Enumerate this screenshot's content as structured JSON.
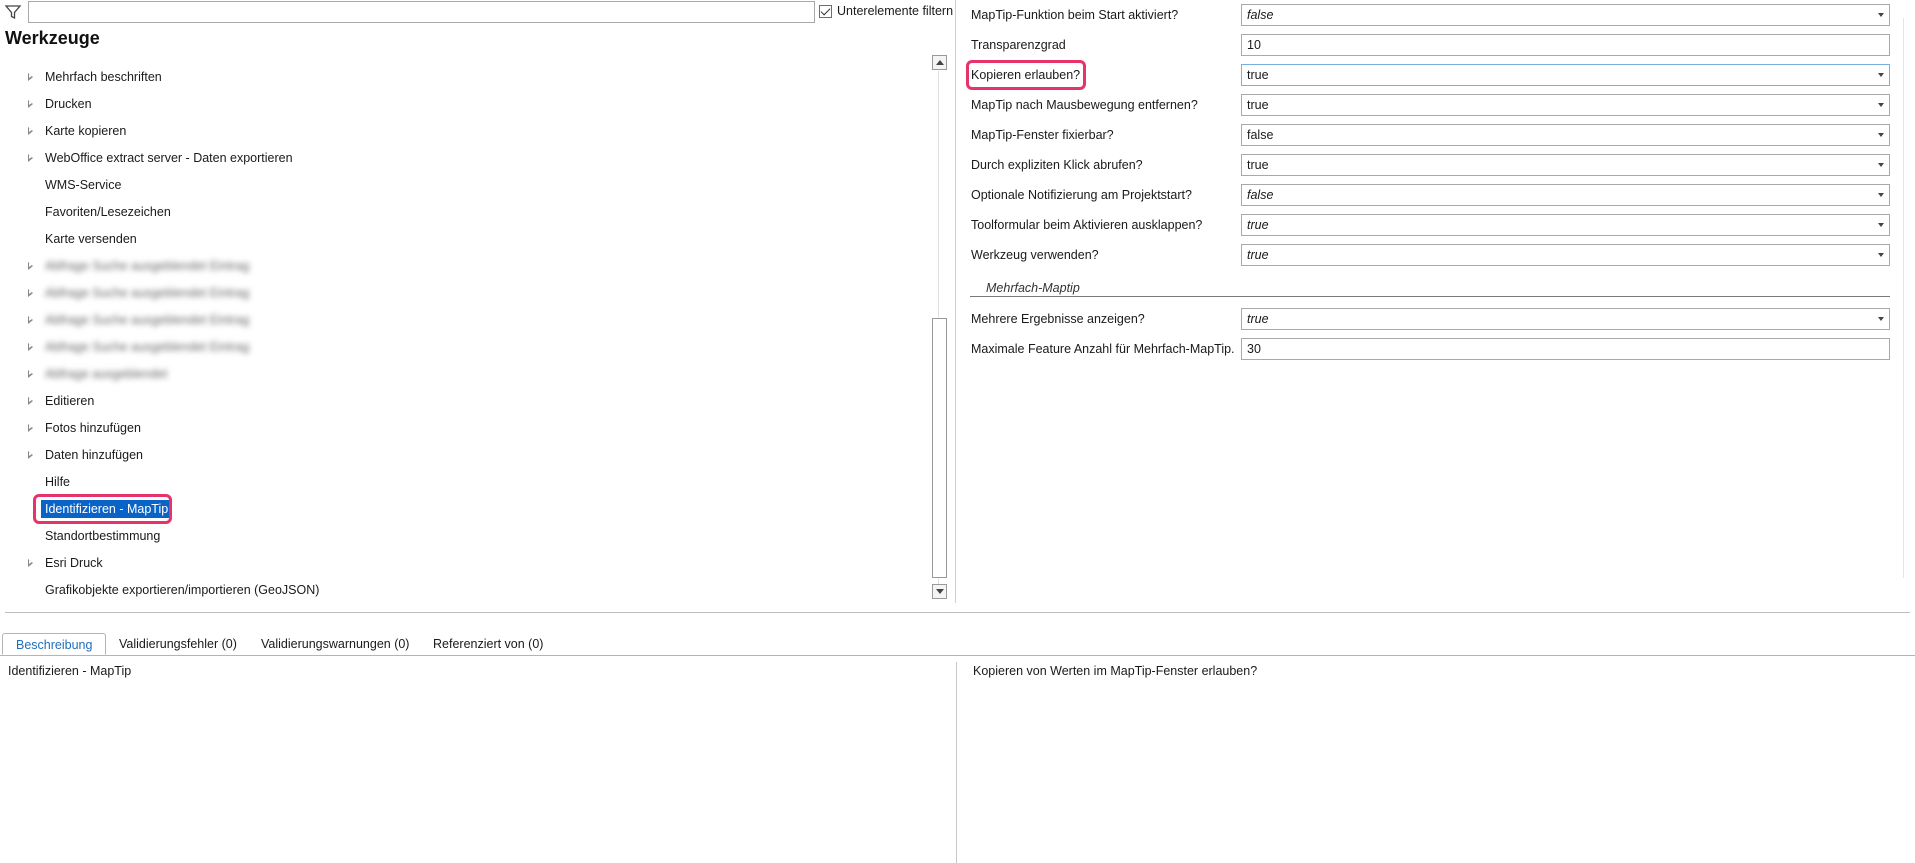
{
  "filter": {
    "input_value": "",
    "sub_filter_label": "Unterelemente filtern",
    "sub_filter_checked": true
  },
  "tree": {
    "title": "Werkzeuge",
    "items": [
      {
        "label": "Mehrfach beschriften",
        "expandable": true
      },
      {
        "label": "Drucken",
        "expandable": true
      },
      {
        "label": "Karte kopieren",
        "expandable": true
      },
      {
        "label": "WebOffice extract server - Daten exportieren",
        "expandable": true
      },
      {
        "label": "WMS-Service",
        "expandable": false
      },
      {
        "label": "Favoriten/Lesezeichen",
        "expandable": false
      },
      {
        "label": "Karte versenden",
        "expandable": false
      },
      {
        "label": "Abfrage Suche ausgeblendet Eintrag",
        "expandable": true,
        "blurred": true
      },
      {
        "label": "Abfrage Suche ausgeblendet Eintrag",
        "expandable": true,
        "blurred": true
      },
      {
        "label": "Abfrage Suche ausgeblendet Eintrag",
        "expandable": true,
        "blurred": true
      },
      {
        "label": "Abfrage Suche ausgeblendet Eintrag",
        "expandable": true,
        "blurred": true
      },
      {
        "label": "Abfrage ausgeblendet",
        "expandable": true,
        "blurred": true
      },
      {
        "label": "Editieren",
        "expandable": true
      },
      {
        "label": "Fotos hinzufügen",
        "expandable": true
      },
      {
        "label": "Daten hinzufügen",
        "expandable": true
      },
      {
        "label": "Hilfe",
        "expandable": false
      },
      {
        "label": "Identifizieren - MapTip",
        "expandable": false,
        "selected": true
      },
      {
        "label": "Standortbestimmung",
        "expandable": false
      },
      {
        "label": "Esri Druck",
        "expandable": true
      },
      {
        "label": "Grafikobjekte exportieren/importieren (GeoJSON)",
        "expandable": false
      }
    ]
  },
  "properties": {
    "rows": [
      {
        "label": "MapTip-Funktion beim Start aktiviert?",
        "value": "false",
        "italic": true,
        "dropdown": true
      },
      {
        "label": "Transparenzgrad",
        "value": "10",
        "italic": false,
        "dropdown": false
      },
      {
        "label": "Kopieren erlauben?",
        "value": "true",
        "italic": false,
        "dropdown": true,
        "highlighted": true
      },
      {
        "label": "MapTip nach Mausbewegung entfernen?",
        "value": "true",
        "italic": false,
        "dropdown": true
      },
      {
        "label": "MapTip-Fenster fixierbar?",
        "value": "false",
        "italic": false,
        "dropdown": true
      },
      {
        "label": "Durch expliziten Klick abrufen?",
        "value": "true",
        "italic": false,
        "dropdown": true
      },
      {
        "label": "Optionale Notifizierung am Projektstart?",
        "value": "false",
        "italic": true,
        "dropdown": true
      },
      {
        "label": "Toolformular beim Aktivieren ausklappen?",
        "value": "true",
        "italic": true,
        "dropdown": true
      },
      {
        "label": "Werkzeug verwenden?",
        "value": "true",
        "italic": true,
        "dropdown": true
      }
    ],
    "section": "Mehrfach-Maptip",
    "section_rows": [
      {
        "label": "Mehrere Ergebnisse anzeigen?",
        "value": "true",
        "italic": true,
        "dropdown": true
      },
      {
        "label": "Maximale Feature Anzahl für Mehrfach-MapTip.",
        "value": "30",
        "italic": false,
        "dropdown": false
      }
    ]
  },
  "tabs": [
    {
      "label": "Beschreibung",
      "active": true
    },
    {
      "label": "Validierungsfehler (0)",
      "active": false
    },
    {
      "label": "Validierungswarnungen (0)",
      "active": false
    },
    {
      "label": "Referenziert von (0)",
      "active": false
    }
  ],
  "description": {
    "left": "Identifizieren - MapTip",
    "right": "Kopieren von Werten im MapTip-Fenster erlauben?"
  },
  "colors": {
    "selection": "#0a64c8",
    "highlight": "#e8336a",
    "active_tab": "#1f6fba"
  }
}
